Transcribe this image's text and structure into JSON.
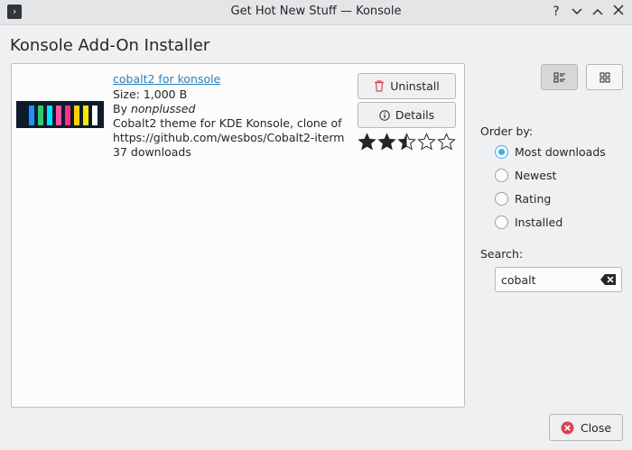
{
  "window": {
    "title": "Get Hot New Stuff — Konsole",
    "help_glyph": "?",
    "minimize_glyph": "⌄",
    "maximize_glyph": "⌃"
  },
  "heading": "Konsole Add-On Installer",
  "item": {
    "title": "cobalt2 for konsole",
    "size": "Size: 1,000 B",
    "by_prefix": "By ",
    "author": "nonplussed",
    "description_line1": "Cobalt2 theme for KDE Konsole, clone of",
    "description_line2": "https://github.com/wesbos/Cobalt2-iterm",
    "downloads": "37 downloads",
    "rating_stars": 2.5,
    "rating_max": 5,
    "thumb_colors": [
      "#1e90ff",
      "#2ecc71",
      "#00e5ff",
      "#ff4fa3",
      "#ff2e88",
      "#ffd400",
      "#ffe600",
      "#ffffff"
    ],
    "uninstall_label": "Uninstall",
    "details_label": "Details"
  },
  "order_by": {
    "label": "Order by:",
    "options": [
      "Most downloads",
      "Newest",
      "Rating",
      "Installed"
    ],
    "selected_index": 0
  },
  "search": {
    "label": "Search:",
    "value": "cobalt"
  },
  "close_label": "Close",
  "colors": {
    "accent": "#3daee9",
    "link": "#2980b9",
    "danger": "#da4453"
  }
}
